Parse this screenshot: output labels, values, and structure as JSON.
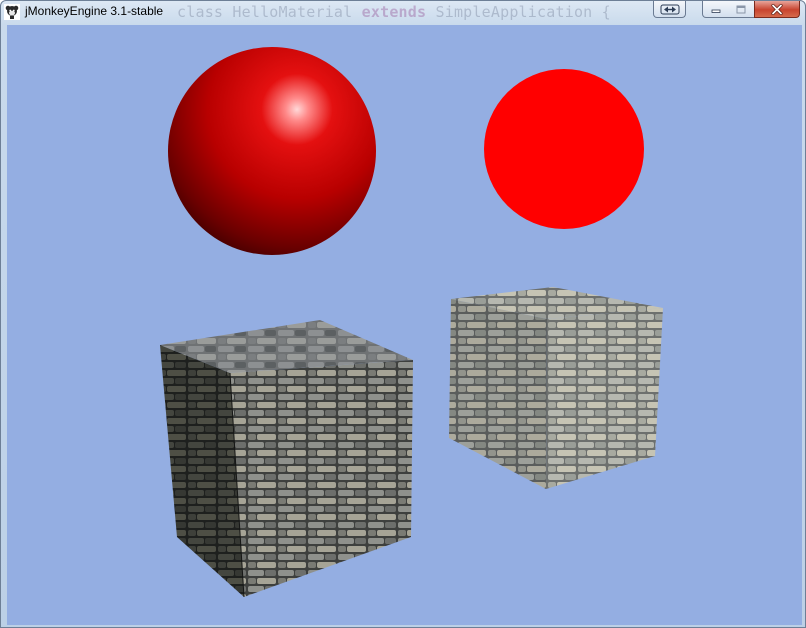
{
  "window": {
    "title": "jMonkeyEngine 3.1-stable",
    "icon": "jmonkey-app-icon",
    "background_code": {
      "prefix": "class HelloMaterial",
      "keyword": "extends",
      "suffix": "SimpleApplication {"
    },
    "controls": [
      "switch-icon",
      "minimize-icon",
      "maximize-icon",
      "close-icon"
    ]
  },
  "scene": {
    "background_color": "#94aee2",
    "objects": [
      {
        "name": "shiny-red-sphere",
        "material": "lit shiny red",
        "color": "#d40000"
      },
      {
        "name": "unshaded-red-sphere",
        "material": "unshaded red",
        "color": "#ff0000"
      },
      {
        "name": "rock-brick-cube-left",
        "material": "stone brick texture (dark, lit)"
      },
      {
        "name": "rock-brick-cube-right",
        "material": "stone brick texture (bright)"
      }
    ]
  }
}
